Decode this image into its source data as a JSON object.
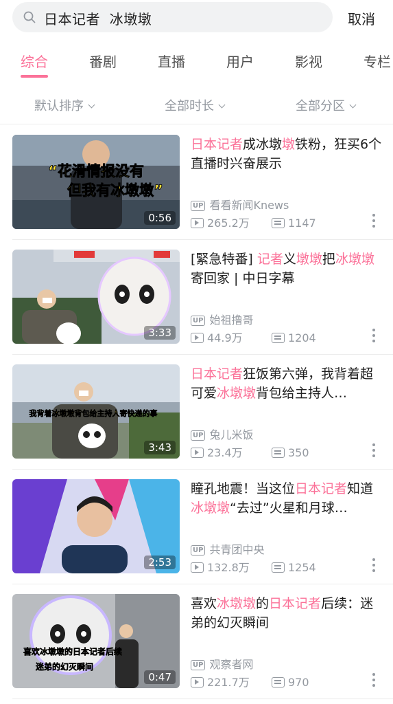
{
  "search": {
    "query": "日本记者  冰墩墩",
    "cancel_label": "取消"
  },
  "tabs": [
    {
      "label": "综合",
      "active": true
    },
    {
      "label": "番剧"
    },
    {
      "label": "直播"
    },
    {
      "label": "用户"
    },
    {
      "label": "影视"
    },
    {
      "label": "专栏"
    }
  ],
  "filters": [
    {
      "label": "默认排序"
    },
    {
      "label": "全部时长"
    },
    {
      "label": "全部分区"
    }
  ],
  "up_badge": "UP",
  "colors": {
    "accent": "#fb7299",
    "muted": "#9499a0"
  },
  "videos": [
    {
      "title_parts": [
        {
          "text": "日本记者",
          "hl": true
        },
        {
          "text": "成冰墩",
          "hl": false
        },
        {
          "text": "墩",
          "hl": true
        },
        {
          "text": "铁粉，狂买6个直播时兴奋展示",
          "hl": false
        }
      ],
      "uploader": "看看新闻Knews",
      "views": "265.2万",
      "danmaku": "1147",
      "duration": "0:56",
      "thumb_caption": [
        "“花滑情报没有",
        "但我有冰墩墩”"
      ]
    },
    {
      "title_parts": [
        {
          "text": "[緊急特番] ",
          "hl": false
        },
        {
          "text": "记者",
          "hl": true
        },
        {
          "text": "义",
          "hl": false
        },
        {
          "text": "墩墩",
          "hl": true
        },
        {
          "text": "把",
          "hl": false
        },
        {
          "text": "冰墩墩",
          "hl": true
        },
        {
          "text": "寄回家 | 中日字幕",
          "hl": false
        }
      ],
      "uploader": "始祖撸哥",
      "views": "44.9万",
      "danmaku": "1204",
      "duration": "3:33",
      "thumb_caption": []
    },
    {
      "title_parts": [
        {
          "text": "日本记者",
          "hl": true
        },
        {
          "text": "狂饭第六弹，我背着超可爱",
          "hl": false
        },
        {
          "text": "冰墩墩",
          "hl": true
        },
        {
          "text": "背包给主持人…",
          "hl": false
        }
      ],
      "uploader": "兔儿米饭",
      "views": "23.4万",
      "danmaku": "350",
      "duration": "3:43",
      "thumb_caption": [
        "我背着冰墩墩背包给主持人寄快递的事"
      ]
    },
    {
      "title_parts": [
        {
          "text": "瞳孔地震！当这位",
          "hl": false
        },
        {
          "text": "日本记者",
          "hl": true
        },
        {
          "text": "知道",
          "hl": false
        },
        {
          "text": "冰墩墩",
          "hl": true
        },
        {
          "text": "“去过”火星和月球…",
          "hl": false
        }
      ],
      "uploader": "共青团中央",
      "views": "132.8万",
      "danmaku": "1254",
      "duration": "2:53",
      "thumb_caption": []
    },
    {
      "title_parts": [
        {
          "text": "喜欢",
          "hl": false
        },
        {
          "text": "冰墩墩",
          "hl": true
        },
        {
          "text": "的",
          "hl": false
        },
        {
          "text": "日本记者",
          "hl": true
        },
        {
          "text": "后续：迷弟的幻灭瞬间",
          "hl": false
        }
      ],
      "uploader": "观察者网",
      "views": "221.7万",
      "danmaku": "970",
      "duration": "0:47",
      "thumb_caption": [
        "喜欢冰墩墩的日本记者后续",
        "迷弟的幻灭瞬间"
      ]
    }
  ]
}
